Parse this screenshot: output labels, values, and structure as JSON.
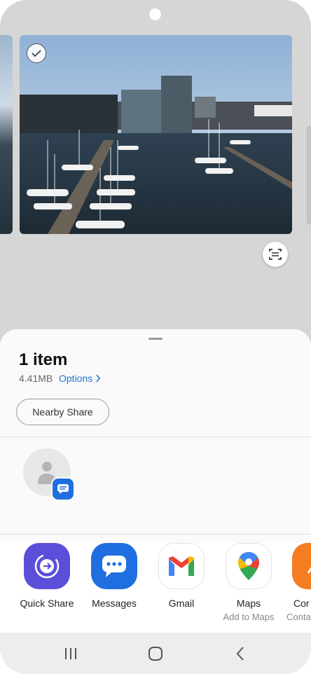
{
  "preview": {
    "selected": true
  },
  "share": {
    "title": "1 item",
    "size": "4.41MB",
    "options_label": "Options",
    "nearby_label": "Nearby Share"
  },
  "apps": [
    {
      "label": "Quick Share",
      "sublabel": ""
    },
    {
      "label": "Messages",
      "sublabel": ""
    },
    {
      "label": "Gmail",
      "sublabel": ""
    },
    {
      "label": "Maps",
      "sublabel": "Add to Maps"
    },
    {
      "label": "Cor",
      "sublabel": "Conta"
    }
  ],
  "colors": {
    "accent": "#1a73d8",
    "quick_share": "#5b4fd9",
    "messages": "#1f6fe0"
  }
}
